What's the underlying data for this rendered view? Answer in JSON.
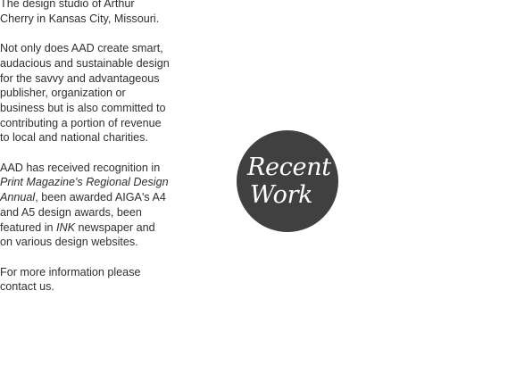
{
  "intro": {
    "text": "The design studio of Arthur Cherry in Kansas City, Missouri."
  },
  "mission": {
    "text": "Not only does AAD create smart, audacious and sustainable design for the savvy and advantageous publisher, organization or business but is also committed to contributing a portion of revenue to local and national charities."
  },
  "recognition": {
    "part1": "AAD has received recognition in ",
    "publication": "Print Magazine's Regional Design Annual",
    "part2": ", been awarded AIGA's A4 and A5 design awards, been featured in ",
    "newspaper": "INK",
    "part3": " newspaper and on various design websites."
  },
  "contact": {
    "part1": "For more information please ",
    "link_label": "contact us",
    "part2": "."
  },
  "recent_work": {
    "line1": "Recent",
    "line2": "Work"
  },
  "colors": {
    "badge_background": "#404040",
    "badge_text": "#ffffff",
    "body_text": "#2f2f2f"
  }
}
